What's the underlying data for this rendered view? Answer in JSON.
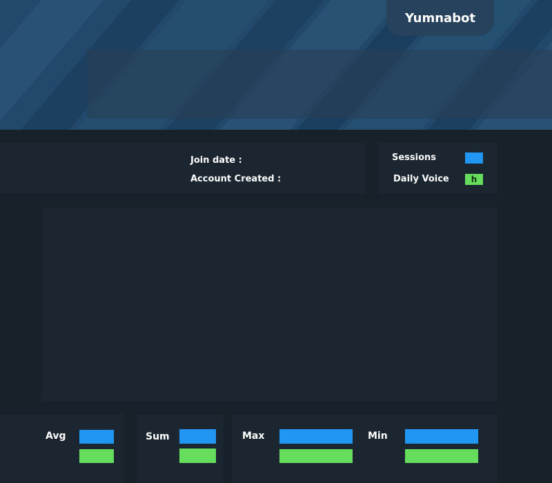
{
  "header": {
    "bot_name": "Yumnabot"
  },
  "profile": {
    "join_date_label": "Join date  :",
    "join_date_value": "",
    "account_created_label": "Account Created :",
    "account_created_value": ""
  },
  "stats": {
    "sessions_label": "Sessions",
    "sessions_value": "",
    "daily_voice_label": "Daily Voice",
    "daily_voice_value": "h"
  },
  "summary": {
    "avg_label": "Avg",
    "sum_label": "Sum",
    "max_label": "Max",
    "min_label": "Min"
  },
  "colors": {
    "blue": "#2196f3",
    "green": "#66dd5c",
    "background": "#17212a",
    "panel": "#1b2631"
  }
}
